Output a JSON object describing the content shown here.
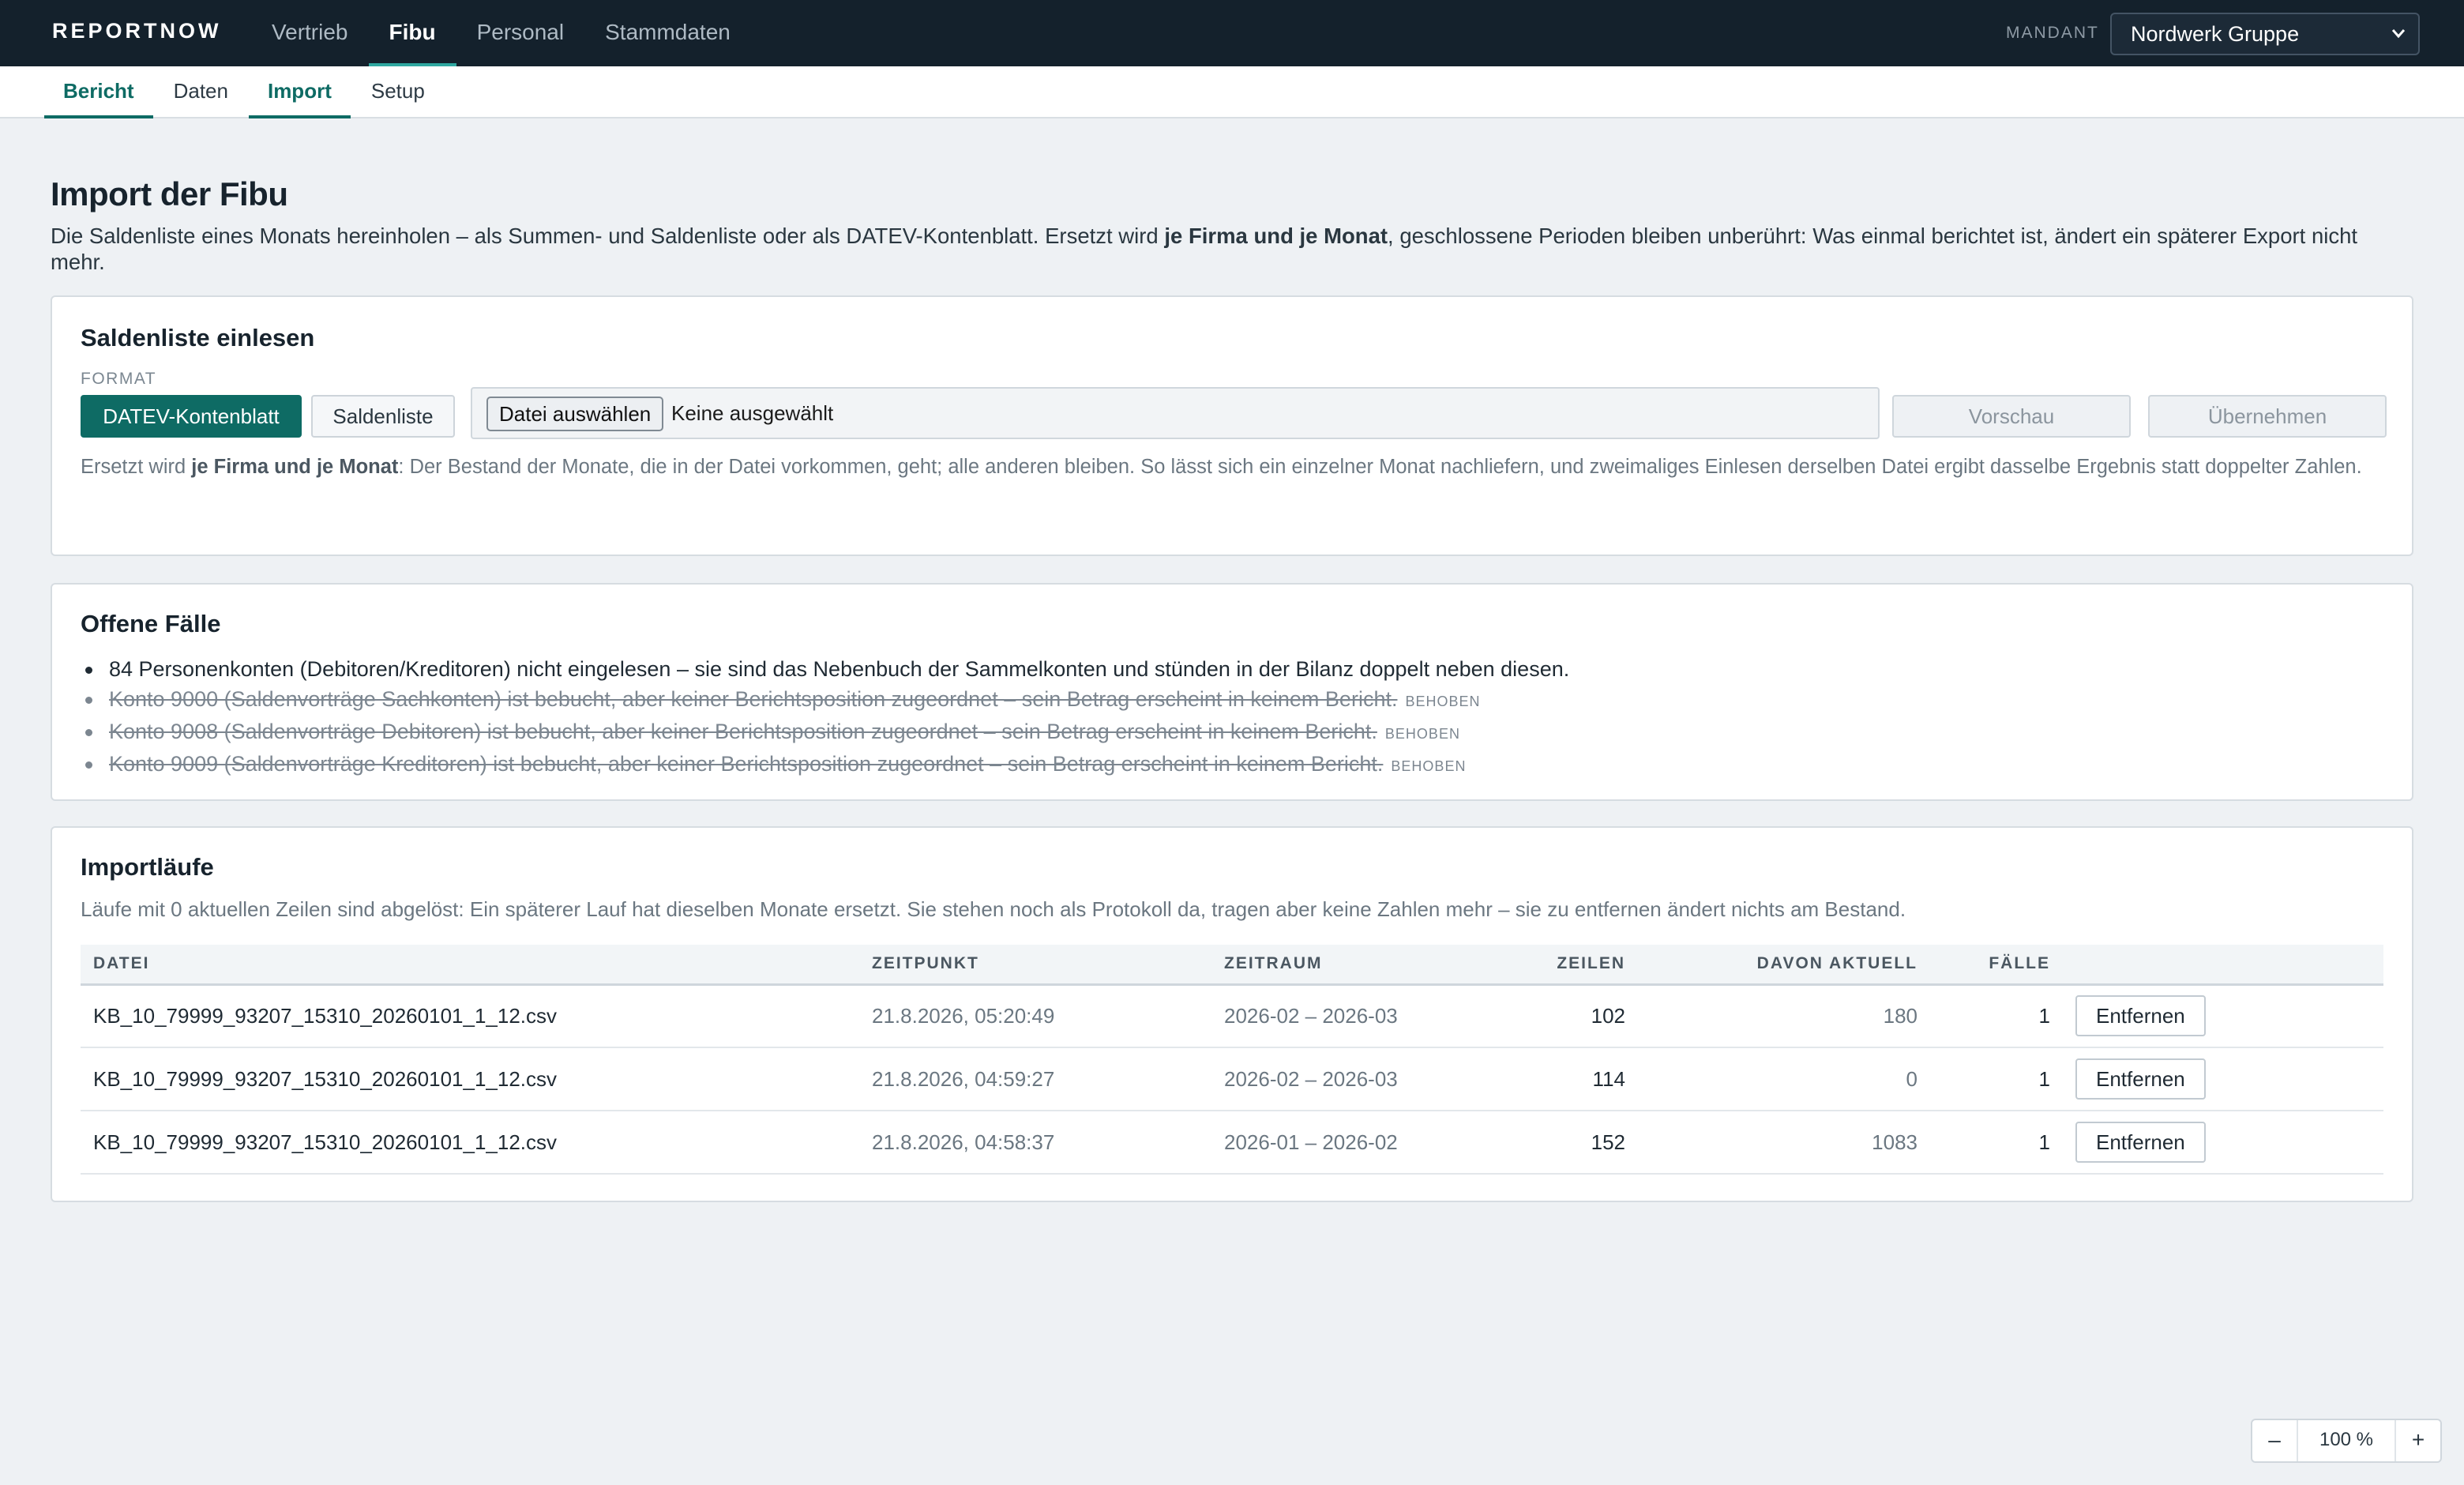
{
  "app": {
    "brand": "REPORTNOW",
    "nav": [
      {
        "label": "Vertrieb"
      },
      {
        "label": "Fibu"
      },
      {
        "label": "Personal"
      },
      {
        "label": "Stammdaten"
      }
    ],
    "mandant_label": "MANDANT",
    "mandant_value": "Nordwerk Gruppe"
  },
  "subnav": [
    {
      "label": "Bericht"
    },
    {
      "label": "Daten"
    },
    {
      "label": "Import"
    },
    {
      "label": "Setup"
    }
  ],
  "page": {
    "title": "Import der Fibu",
    "intro_before": "Die Saldenliste eines Monats hereinholen – als Summen- und Saldenliste oder als DATEV-Kontenblatt. Ersetzt wird ",
    "intro_bold": "je Firma und je Monat",
    "intro_after": ", geschlossene Perioden bleiben unberührt: Was einmal berichtet ist, ändert ein späterer Export nicht mehr."
  },
  "upload": {
    "title": "Saldenliste einlesen",
    "format_label": "FORMAT",
    "format_options": [
      "DATEV-Kontenblatt",
      "Saldenliste"
    ],
    "file_button": "Datei auswählen",
    "file_status": "Keine ausgewählt",
    "preview_label": "Vorschau",
    "apply_label": "Übernehmen",
    "note_before": "Ersetzt wird ",
    "note_bold": "je Firma und je Monat",
    "note_after": ": Der Bestand der Monate, die in der Datei vorkommen, geht; alle anderen bleiben. So lässt sich ein einzelner Monat nachliefern, und zweimaliges Einlesen derselben Datei ergibt dasselbe Ergebnis statt doppelter Zahlen."
  },
  "cases": {
    "title": "Offene Fälle",
    "items": [
      {
        "text": "84 Personenkonten (Debitoren/Kreditoren) nicht eingelesen – sie sind das Nebenbuch der Sammelkonten und stünden in der Bilanz doppelt neben diesen.",
        "tag": ""
      },
      {
        "text": "Konto 9000 (Saldenvorträge Sachkonten) ist bebucht, aber keiner Berichtsposition zugeordnet – sein Betrag erscheint in keinem Bericht.",
        "tag": "BEHOBEN"
      },
      {
        "text": "Konto 9008 (Saldenvorträge Debitoren) ist bebucht, aber keiner Berichtsposition zugeordnet – sein Betrag erscheint in keinem Bericht.",
        "tag": "BEHOBEN"
      },
      {
        "text": "Konto 9009 (Saldenvorträge Kreditoren) ist bebucht, aber keiner Berichtsposition zugeordnet – sein Betrag erscheint in keinem Bericht.",
        "tag": "BEHOBEN"
      }
    ]
  },
  "runs": {
    "title": "Importläufe",
    "note": "Läufe mit 0 aktuellen Zeilen sind abgelöst: Ein späterer Lauf hat dieselben Monate ersetzt. Sie stehen noch als Protokoll da, tragen aber keine Zahlen mehr – sie zu entfernen ändert nichts am Bestand.",
    "columns": [
      "DATEI",
      "ZEITPUNKT",
      "ZEITRAUM",
      "ZEILEN",
      "DAVON AKTUELL",
      "FÄLLE"
    ],
    "remove_label": "Entfernen",
    "rows": [
      {
        "file": "KB_10_79999_93207_15310_20260101_1_12.csv",
        "time": "21.8.2026, 05:20:49",
        "range": "2026-02 – 2026-03",
        "lines": "102",
        "current": "180",
        "cases": "1"
      },
      {
        "file": "KB_10_79999_93207_15310_20260101_1_12.csv",
        "time": "21.8.2026, 04:59:27",
        "range": "2026-02 – 2026-03",
        "lines": "114",
        "current": "0",
        "cases": "1"
      },
      {
        "file": "KB_10_79999_93207_15310_20260101_1_12.csv",
        "time": "21.8.2026, 04:58:37",
        "range": "2026-01 – 2026-02",
        "lines": "152",
        "current": "1083",
        "cases": "1"
      }
    ]
  },
  "zoom": {
    "minus": "–",
    "value": "100 %",
    "plus": "+"
  }
}
